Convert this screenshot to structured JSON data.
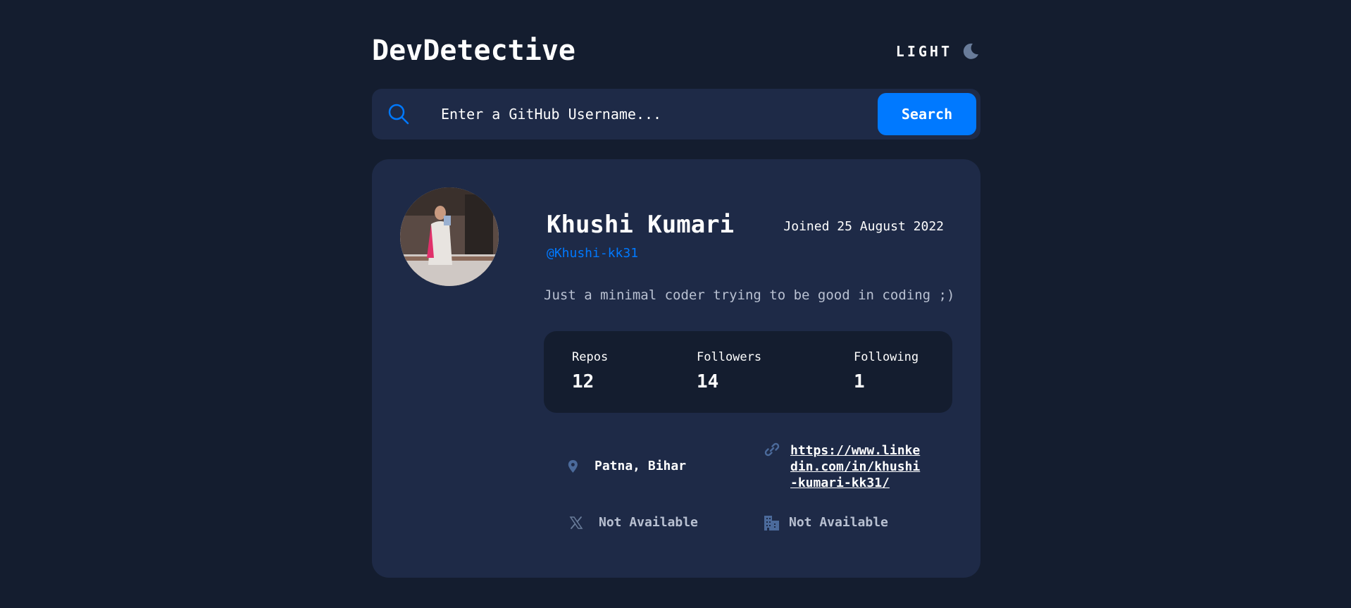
{
  "header": {
    "title": "DevDetective",
    "theme_label": "LIGHT",
    "theme_icon": "moon-icon"
  },
  "search": {
    "placeholder": "Enter a GitHub Username...",
    "button_label": "Search",
    "icon": "search-icon"
  },
  "profile": {
    "name": "Khushi Kumari",
    "joined": "Joined 25 August 2022",
    "username": "@Khushi-kk31",
    "bio": "Just a minimal coder trying to be good in coding ;)",
    "stats": [
      {
        "label": "Repos",
        "value": "12"
      },
      {
        "label": "Followers",
        "value": "14"
      },
      {
        "label": "Following",
        "value": "1"
      }
    ],
    "location": "Patna, Bihar",
    "website": "https://www.linkedin.com/in/khushi-kumari-kk31/",
    "twitter": "Not Available",
    "company": "Not Available"
  },
  "colors": {
    "background": "#141d2f",
    "card": "#1e2a47",
    "accent": "#0079ff",
    "muted_text": "#b9c1d2"
  }
}
